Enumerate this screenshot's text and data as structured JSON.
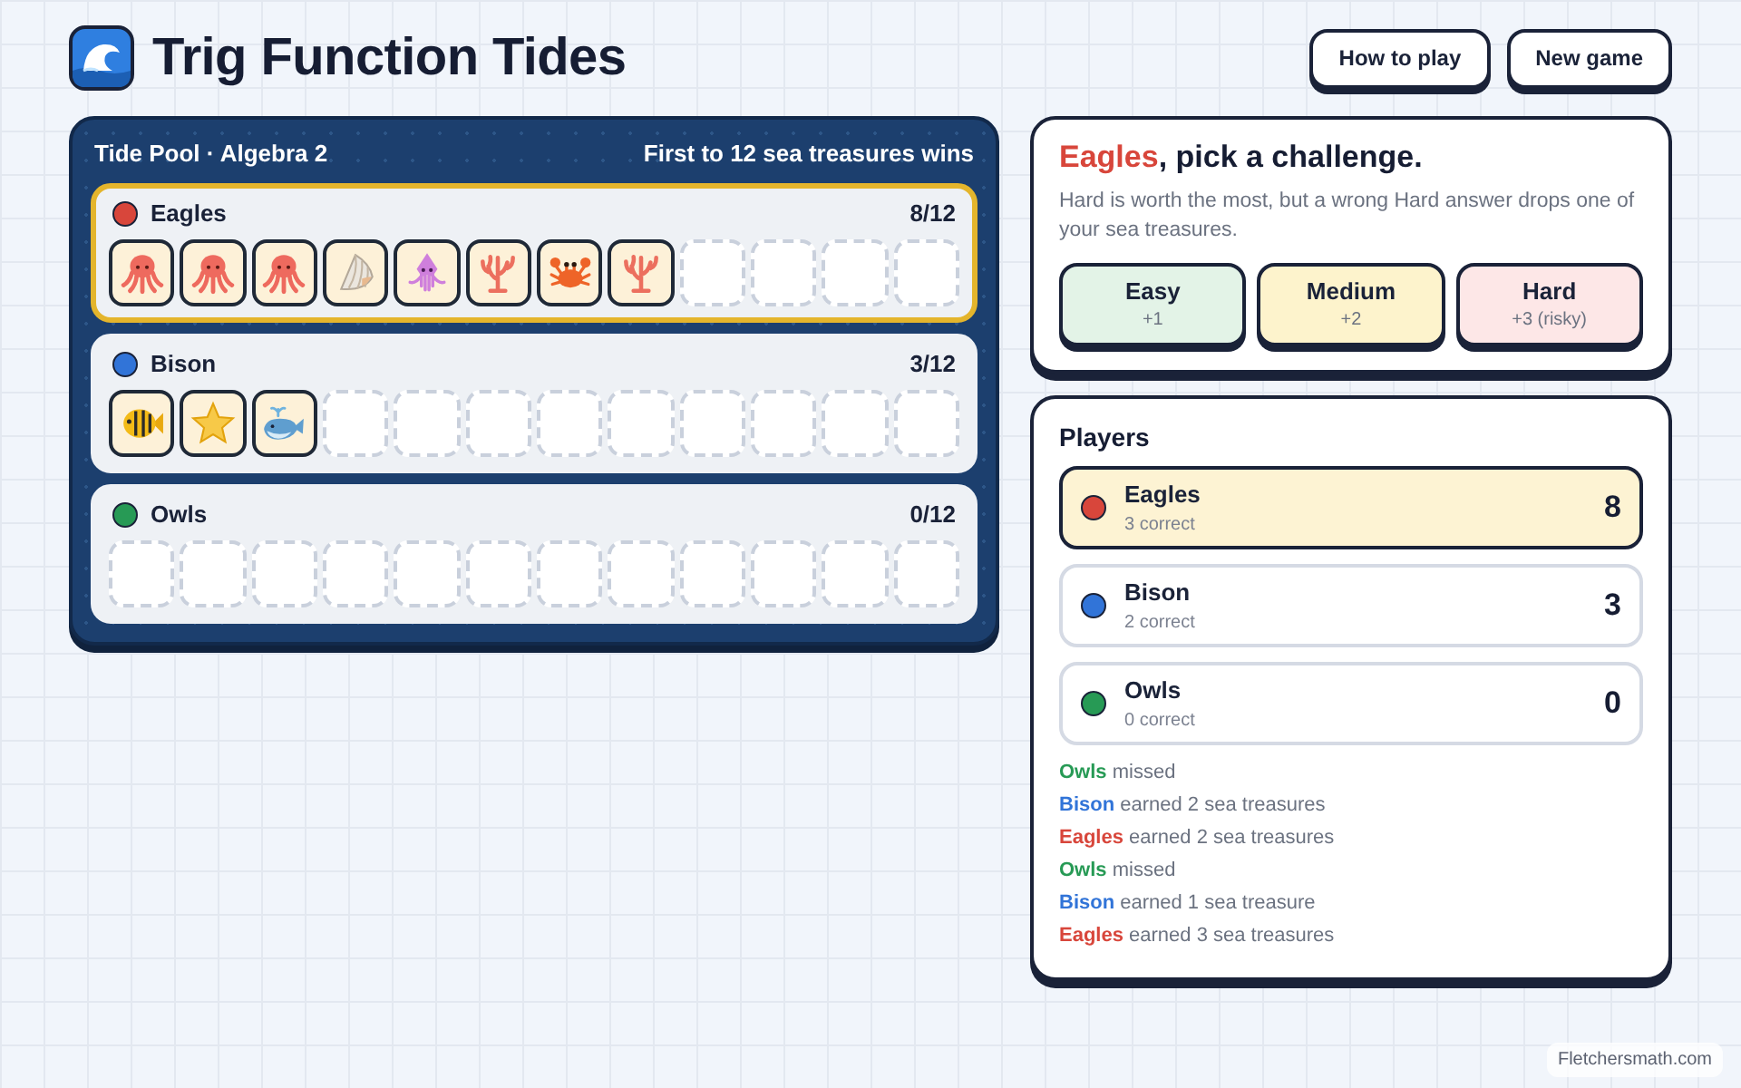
{
  "header": {
    "title": "Trig Function Tides",
    "buttons": [
      "How to play",
      "New game"
    ]
  },
  "board": {
    "title": "Tide Pool · Algebra 2",
    "goal": "First to 12 sea treasures wins",
    "teams": [
      {
        "name": "Eagles",
        "color": "#d8463b",
        "score": "8/12",
        "selected": true,
        "slots": [
          {
            "kind": "octopus"
          },
          {
            "kind": "octopus"
          },
          {
            "kind": "octopus"
          },
          {
            "kind": "shell"
          },
          {
            "kind": "squid"
          },
          {
            "kind": "coral"
          },
          {
            "kind": "crab"
          },
          {
            "kind": "coral"
          },
          {
            "kind": "empty"
          },
          {
            "kind": "empty"
          },
          {
            "kind": "empty"
          },
          {
            "kind": "empty"
          }
        ]
      },
      {
        "name": "Bison",
        "color": "#3174d8",
        "score": "3/12",
        "selected": false,
        "slots": [
          {
            "kind": "fish"
          },
          {
            "kind": "star"
          },
          {
            "kind": "whale"
          },
          {
            "kind": "empty"
          },
          {
            "kind": "empty"
          },
          {
            "kind": "empty"
          },
          {
            "kind": "empty"
          },
          {
            "kind": "empty"
          },
          {
            "kind": "empty"
          },
          {
            "kind": "empty"
          },
          {
            "kind": "empty"
          },
          {
            "kind": "empty"
          }
        ]
      },
      {
        "name": "Owls",
        "color": "#279a55",
        "score": "0/12",
        "selected": false,
        "slots": [
          {
            "kind": "empty"
          },
          {
            "kind": "empty"
          },
          {
            "kind": "empty"
          },
          {
            "kind": "empty"
          },
          {
            "kind": "empty"
          },
          {
            "kind": "empty"
          },
          {
            "kind": "empty"
          },
          {
            "kind": "empty"
          },
          {
            "kind": "empty"
          },
          {
            "kind": "empty"
          },
          {
            "kind": "empty"
          },
          {
            "kind": "empty"
          }
        ]
      }
    ]
  },
  "challenge": {
    "player": "Eagles",
    "color": "#d8463b",
    "prompt": ", pick a challenge.",
    "description": "Hard is worth the most, but a wrong Hard answer drops one of your sea treasures.",
    "options": [
      {
        "label": "Easy",
        "points": "+1",
        "color": "#e3f3e7"
      },
      {
        "label": "Medium",
        "points": "+2",
        "color": "#fdf3cc"
      },
      {
        "label": "Hard",
        "points": "+3 (risky)",
        "color": "#fde7e7"
      }
    ]
  },
  "players": {
    "title": "Players",
    "items": [
      {
        "name": "Eagles",
        "color": "#d8463b",
        "correct": "3 correct",
        "score": "8",
        "selected": true
      },
      {
        "name": "Bison",
        "color": "#3174d8",
        "correct": "2 correct",
        "score": "3",
        "selected": false
      },
      {
        "name": "Owls",
        "color": "#279a55",
        "correct": "0 correct",
        "score": "0",
        "selected": false
      }
    ]
  },
  "log": [
    {
      "player": "Owls",
      "color": "#279a55",
      "text": "missed"
    },
    {
      "player": "Bison",
      "color": "#3174d8",
      "text": "earned 2 sea treasures"
    },
    {
      "player": "Eagles",
      "color": "#d8463b",
      "text": "earned 2 sea treasures"
    },
    {
      "player": "Owls",
      "color": "#279a55",
      "text": "missed"
    },
    {
      "player": "Bison",
      "color": "#3174d8",
      "text": "earned 1 sea treasure"
    },
    {
      "player": "Eagles",
      "color": "#d8463b",
      "text": "earned 3 sea treasures"
    }
  ],
  "credit": "Fletchersmath.com"
}
